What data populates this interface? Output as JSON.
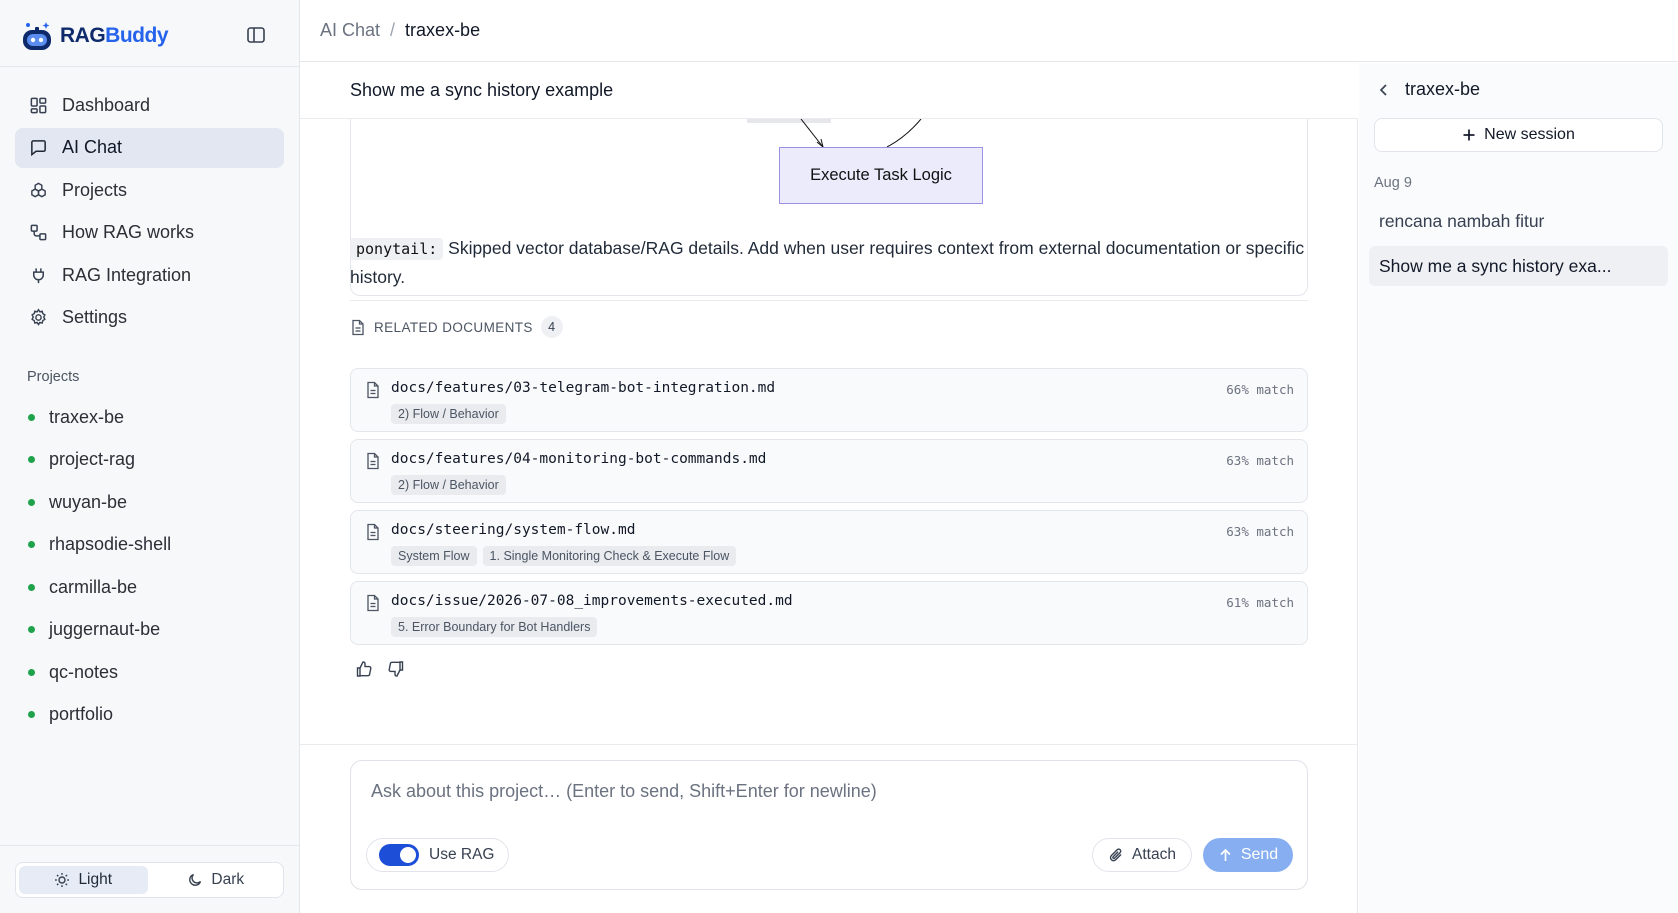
{
  "brand": {
    "part1": "RAG",
    "part2": "Buddy"
  },
  "nav": [
    {
      "label": "Dashboard",
      "icon": "dashboard-icon"
    },
    {
      "label": "AI Chat",
      "icon": "chat-icon",
      "active": true
    },
    {
      "label": "Projects",
      "icon": "projects-icon"
    },
    {
      "label": "How RAG works",
      "icon": "workflow-icon"
    },
    {
      "label": "RAG Integration",
      "icon": "plug-icon"
    },
    {
      "label": "Settings",
      "icon": "gear-icon"
    }
  ],
  "projects": {
    "heading": "Projects",
    "items": [
      "traxex-be",
      "project-rag",
      "wuyan-be",
      "rhapsodie-shell",
      "carmilla-be",
      "juggernaut-be",
      "qc-notes",
      "portfolio"
    ],
    "dot_color": "#1fa34a"
  },
  "theme": {
    "light": "Light",
    "dark": "Dark",
    "active": "Light"
  },
  "breadcrumb": {
    "root": "AI Chat",
    "separator": "/",
    "current": "traxex-be"
  },
  "chat": {
    "title": "Show me a sync history example",
    "diagram_node": "Execute Task Logic",
    "note": {
      "code": "ponytail:",
      "text": " Skipped vector database/RAG details. Add when user requires context from external documentation or specific history."
    },
    "related": {
      "heading": "RELATED DOCUMENTS",
      "count": "4",
      "docs": [
        {
          "path": "docs/features/03-telegram-bot-integration.md",
          "match": "66% match",
          "tags": [
            "2) Flow / Behavior"
          ]
        },
        {
          "path": "docs/features/04-monitoring-bot-commands.md",
          "match": "63% match",
          "tags": [
            "2) Flow / Behavior"
          ]
        },
        {
          "path": "docs/steering/system-flow.md",
          "match": "63% match",
          "tags": [
            "System Flow",
            "1. Single Monitoring Check & Execute Flow"
          ]
        },
        {
          "path": "docs/issue/2026-07-08_improvements-executed.md",
          "match": "61% match",
          "tags": [
            "5. Error Boundary for Bot Handlers"
          ]
        }
      ]
    }
  },
  "composer": {
    "placeholder": "Ask about this project… (Enter to send, Shift+Enter for newline)",
    "value": "",
    "rag_label": "Use RAG",
    "rag_enabled": true,
    "attach_label": "Attach",
    "send_label": "Send"
  },
  "sessions": {
    "project": "traxex-be",
    "new_label": "New session",
    "date": "Aug 9",
    "items": [
      {
        "label": "rencana nambah fitur",
        "active": false
      },
      {
        "label": "Show me a sync history exa...",
        "active": true
      }
    ]
  },
  "colors": {
    "accent": "#2563eb",
    "toggle_on": "#1d4ed8",
    "send_disabled": "#86aef0",
    "node_fill": "#ecebfc",
    "node_border": "#9b8fe6"
  }
}
